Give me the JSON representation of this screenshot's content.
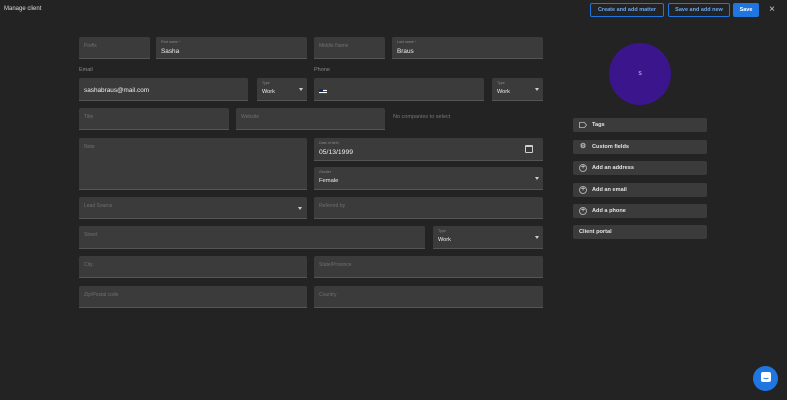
{
  "header": {
    "title": "Manage client",
    "create_and_add_matter": "Create and add matter",
    "save_and_add_new": "Save and add new",
    "save": "Save",
    "close_glyph": "×"
  },
  "form": {
    "prefix": {
      "label": "Prefix"
    },
    "first_name": {
      "label": "First name",
      "required_mark": "*",
      "value": "Sasha"
    },
    "middle_name": {
      "label": "Middle Name"
    },
    "last_name": {
      "label": "Last name",
      "required_mark": "*",
      "value": "Braus"
    },
    "email_section_label": "Email",
    "email": {
      "value": "sashabraus@mail.com"
    },
    "email_type": {
      "label": "Type",
      "value": "Work"
    },
    "phone_section_label": "Phone",
    "phone": {
      "value": ""
    },
    "phone_type": {
      "label": "Type",
      "value": "Work"
    },
    "title_field": {
      "label": "Title"
    },
    "website": {
      "label": "Website"
    },
    "no_companies": "No companies to select",
    "note": {
      "label": "Note"
    },
    "date_of_birth": {
      "label": "Date of birth",
      "value": "05/13/1999"
    },
    "gender": {
      "label": "Gender",
      "value": "Female"
    },
    "lead_source": {
      "label": "Lead Source"
    },
    "referred_by": {
      "label": "Referred by"
    },
    "street": {
      "label": "Street"
    },
    "address_type": {
      "label": "Type",
      "value": "Work"
    },
    "city": {
      "label": "City"
    },
    "state": {
      "label": "State/Province"
    },
    "zip": {
      "label": "Zip/Postal code"
    },
    "country": {
      "label": "Country"
    }
  },
  "sidebar": {
    "avatar_initial": "S",
    "items": [
      {
        "label": "Tags",
        "icon": "tag-icon"
      },
      {
        "label": "Custom fields",
        "icon": "gear-icon"
      },
      {
        "label": "Add an address",
        "icon": "plus-circle-icon"
      },
      {
        "label": "Add an email",
        "icon": "plus-circle-icon"
      },
      {
        "label": "Add a phone",
        "icon": "plus-circle-icon"
      },
      {
        "label": "Client portal",
        "icon": ""
      }
    ]
  },
  "colors": {
    "background": "#232323",
    "field": "#3b3b3b",
    "accent": "#1f76e0",
    "avatar": "#3a158c"
  }
}
